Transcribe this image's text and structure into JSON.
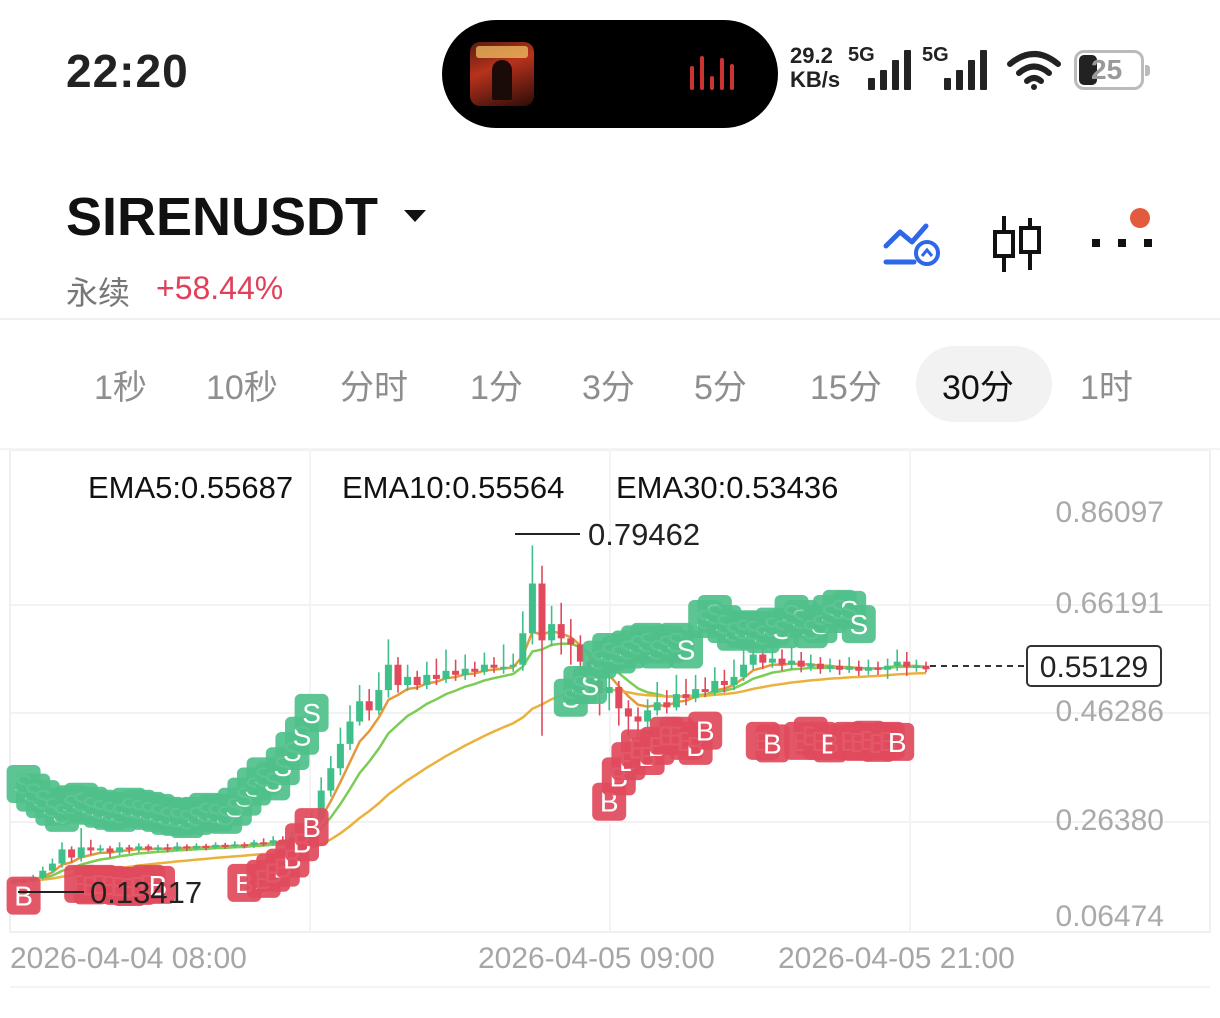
{
  "status_bar": {
    "time": "22:20",
    "net_speed_value": "29.2",
    "net_speed_unit": "KB/s",
    "signal1_label": "5G",
    "signal2_label": "5G",
    "battery": "25"
  },
  "header": {
    "symbol": "SIRENUSDT",
    "contract_type": "永续",
    "change": "+58.44%",
    "icons": [
      "indicator-alert-icon",
      "candlestick-icon",
      "more-icon"
    ]
  },
  "timeframes": [
    {
      "label": "1秒",
      "active": false
    },
    {
      "label": "10秒",
      "active": false
    },
    {
      "label": "分时",
      "active": false
    },
    {
      "label": "1分",
      "active": false
    },
    {
      "label": "3分",
      "active": false
    },
    {
      "label": "5分",
      "active": false
    },
    {
      "label": "15分",
      "active": false
    },
    {
      "label": "30分",
      "active": true
    },
    {
      "label": "1时",
      "active": false
    }
  ],
  "chart_data": {
    "type": "candlestick",
    "indicators": [
      {
        "name": "EMA5",
        "label": "EMA5:0.55687",
        "value": 0.55687,
        "color": "#e39a3a"
      },
      {
        "name": "EMA10",
        "label": "EMA10:0.55564",
        "value": 0.55564,
        "color": "#7ccc56"
      },
      {
        "name": "EMA30",
        "label": "EMA30:0.53436",
        "value": 0.53436,
        "color": "#eab23c"
      }
    ],
    "y_ticks": [
      "0.86097",
      "0.66191",
      "0.46286",
      "0.26380",
      "0.06474"
    ],
    "ylim": [
      0.06474,
      0.86097
    ],
    "x_ticks": [
      "2026-04-04 08:00",
      "2026-04-05 09:00",
      "2026-04-05 21:00"
    ],
    "high_label": "0.79462",
    "low_label": "0.13417",
    "current_price": "0.55129",
    "colors": {
      "up": "#3fbf8a",
      "down": "#e04a5c",
      "buy_marker": "#e04a5c",
      "sell_marker": "#4fc08a"
    },
    "candles": [
      [
        0.13,
        0.135,
        0.127,
        0.139
      ],
      [
        0.135,
        0.134,
        0.13,
        0.14
      ],
      [
        0.134,
        0.14,
        0.131,
        0.146
      ],
      [
        0.14,
        0.154,
        0.137,
        0.162
      ],
      [
        0.154,
        0.168,
        0.15,
        0.178
      ],
      [
        0.168,
        0.196,
        0.16,
        0.21
      ],
      [
        0.196,
        0.18,
        0.17,
        0.202
      ],
      [
        0.18,
        0.2,
        0.172,
        0.238
      ],
      [
        0.2,
        0.194,
        0.185,
        0.215
      ],
      [
        0.194,
        0.198,
        0.188,
        0.205
      ],
      [
        0.198,
        0.19,
        0.18,
        0.203
      ],
      [
        0.19,
        0.2,
        0.185,
        0.21
      ],
      [
        0.2,
        0.196,
        0.188,
        0.205
      ],
      [
        0.196,
        0.202,
        0.19,
        0.208
      ],
      [
        0.202,
        0.196,
        0.192,
        0.206
      ],
      [
        0.196,
        0.2,
        0.192,
        0.205
      ],
      [
        0.2,
        0.196,
        0.19,
        0.207
      ],
      [
        0.196,
        0.202,
        0.192,
        0.21
      ],
      [
        0.202,
        0.198,
        0.193,
        0.206
      ],
      [
        0.198,
        0.203,
        0.194,
        0.208
      ],
      [
        0.203,
        0.2,
        0.194,
        0.207
      ],
      [
        0.2,
        0.205,
        0.196,
        0.21
      ],
      [
        0.205,
        0.202,
        0.197,
        0.209
      ],
      [
        0.202,
        0.206,
        0.198,
        0.212
      ],
      [
        0.206,
        0.204,
        0.198,
        0.21
      ],
      [
        0.204,
        0.21,
        0.199,
        0.215
      ],
      [
        0.21,
        0.208,
        0.202,
        0.218
      ],
      [
        0.208,
        0.214,
        0.203,
        0.222
      ],
      [
        0.214,
        0.212,
        0.206,
        0.222
      ],
      [
        0.212,
        0.22,
        0.207,
        0.232
      ],
      [
        0.22,
        0.232,
        0.215,
        0.246
      ],
      [
        0.232,
        0.256,
        0.228,
        0.272
      ],
      [
        0.256,
        0.312,
        0.25,
        0.338
      ],
      [
        0.312,
        0.356,
        0.3,
        0.38
      ],
      [
        0.356,
        0.404,
        0.342,
        0.436
      ],
      [
        0.404,
        0.448,
        0.392,
        0.48
      ],
      [
        0.448,
        0.488,
        0.44,
        0.52
      ],
      [
        0.488,
        0.47,
        0.45,
        0.512
      ],
      [
        0.47,
        0.51,
        0.462,
        0.545
      ],
      [
        0.51,
        0.56,
        0.495,
        0.61
      ],
      [
        0.56,
        0.52,
        0.505,
        0.575
      ],
      [
        0.52,
        0.536,
        0.508,
        0.56
      ],
      [
        0.536,
        0.52,
        0.51,
        0.548
      ],
      [
        0.52,
        0.54,
        0.512,
        0.566
      ],
      [
        0.54,
        0.532,
        0.52,
        0.572
      ],
      [
        0.532,
        0.548,
        0.524,
        0.59
      ],
      [
        0.548,
        0.54,
        0.528,
        0.57
      ],
      [
        0.54,
        0.552,
        0.53,
        0.58
      ],
      [
        0.552,
        0.546,
        0.536,
        0.566
      ],
      [
        0.546,
        0.56,
        0.54,
        0.584
      ],
      [
        0.56,
        0.554,
        0.544,
        0.575
      ],
      [
        0.554,
        0.556,
        0.542,
        0.6
      ],
      [
        0.556,
        0.56,
        0.546,
        0.582
      ],
      [
        0.56,
        0.622,
        0.548,
        0.665
      ],
      [
        0.622,
        0.72,
        0.6,
        0.795
      ],
      [
        0.72,
        0.608,
        0.42,
        0.755
      ],
      [
        0.608,
        0.64,
        0.596,
        0.676
      ],
      [
        0.64,
        0.612,
        0.58,
        0.682
      ],
      [
        0.612,
        0.6,
        0.56,
        0.65
      ],
      [
        0.6,
        0.566,
        0.54,
        0.618
      ],
      [
        0.566,
        0.528,
        0.504,
        0.576
      ],
      [
        0.528,
        0.504,
        0.46,
        0.538
      ],
      [
        0.504,
        0.516,
        0.47,
        0.544
      ],
      [
        0.516,
        0.474,
        0.44,
        0.528
      ],
      [
        0.474,
        0.458,
        0.42,
        0.49
      ],
      [
        0.458,
        0.448,
        0.41,
        0.476
      ],
      [
        0.448,
        0.47,
        0.436,
        0.492
      ],
      [
        0.47,
        0.486,
        0.46,
        0.526
      ],
      [
        0.486,
        0.476,
        0.464,
        0.51
      ],
      [
        0.476,
        0.502,
        0.47,
        0.54
      ],
      [
        0.502,
        0.494,
        0.48,
        0.532
      ],
      [
        0.494,
        0.512,
        0.486,
        0.54
      ],
      [
        0.512,
        0.506,
        0.496,
        0.535
      ],
      [
        0.506,
        0.528,
        0.5,
        0.555
      ],
      [
        0.528,
        0.52,
        0.505,
        0.55
      ],
      [
        0.52,
        0.536,
        0.51,
        0.57
      ],
      [
        0.536,
        0.56,
        0.528,
        0.6
      ],
      [
        0.56,
        0.58,
        0.55,
        0.63
      ],
      [
        0.58,
        0.564,
        0.552,
        0.62
      ],
      [
        0.564,
        0.572,
        0.554,
        0.605
      ],
      [
        0.572,
        0.56,
        0.548,
        0.59
      ],
      [
        0.56,
        0.568,
        0.55,
        0.595
      ],
      [
        0.568,
        0.556,
        0.545,
        0.585
      ],
      [
        0.556,
        0.562,
        0.548,
        0.58
      ],
      [
        0.562,
        0.552,
        0.542,
        0.575
      ],
      [
        0.552,
        0.558,
        0.545,
        0.572
      ],
      [
        0.558,
        0.55,
        0.54,
        0.57
      ],
      [
        0.55,
        0.556,
        0.544,
        0.575
      ],
      [
        0.556,
        0.548,
        0.538,
        0.568
      ],
      [
        0.548,
        0.554,
        0.54,
        0.57
      ],
      [
        0.554,
        0.55,
        0.54,
        0.566
      ],
      [
        0.55,
        0.558,
        0.532,
        0.572
      ],
      [
        0.558,
        0.566,
        0.548,
        0.59
      ],
      [
        0.566,
        0.556,
        0.538,
        0.585
      ],
      [
        0.556,
        0.558,
        0.546,
        0.57
      ],
      [
        0.558,
        0.551,
        0.545,
        0.566
      ]
    ],
    "buy_markers": [
      [
        1,
        0.105
      ],
      [
        7,
        0.128
      ],
      [
        8,
        0.125
      ],
      [
        9,
        0.128
      ],
      [
        10,
        0.126
      ],
      [
        11,
        0.124
      ],
      [
        12,
        0.122
      ],
      [
        13,
        0.124
      ],
      [
        14,
        0.128
      ],
      [
        15,
        0.126
      ],
      [
        24,
        0.13
      ],
      [
        26,
        0.138
      ],
      [
        27,
        0.15
      ],
      [
        28,
        0.16
      ],
      [
        29,
        0.178
      ],
      [
        30,
        0.21
      ],
      [
        31,
        0.24
      ],
      [
        62,
        0.29
      ],
      [
        63,
        0.34
      ],
      [
        64,
        0.37
      ],
      [
        65,
        0.395
      ],
      [
        66,
        0.38
      ],
      [
        67,
        0.4
      ],
      [
        68,
        0.42
      ],
      [
        69,
        0.42
      ],
      [
        70,
        0.41
      ],
      [
        71,
        0.4
      ],
      [
        72,
        0.43
      ],
      [
        78,
        0.41
      ],
      [
        79,
        0.405
      ],
      [
        82,
        0.41
      ],
      [
        83,
        0.42
      ],
      [
        84,
        0.41
      ],
      [
        85,
        0.405
      ],
      [
        87,
        0.41
      ],
      [
        88,
        0.408
      ],
      [
        89,
        0.412
      ],
      [
        90,
        0.406
      ],
      [
        91,
        0.41
      ],
      [
        92,
        0.408
      ]
    ],
    "sell_markers": [
      [
        1,
        0.325
      ],
      [
        2,
        0.308
      ],
      [
        3,
        0.295
      ],
      [
        4,
        0.28
      ],
      [
        5,
        0.268
      ],
      [
        6,
        0.285
      ],
      [
        7,
        0.29
      ],
      [
        8,
        0.282
      ],
      [
        9,
        0.276
      ],
      [
        10,
        0.272
      ],
      [
        11,
        0.268
      ],
      [
        12,
        0.28
      ],
      [
        13,
        0.276
      ],
      [
        14,
        0.272
      ],
      [
        15,
        0.268
      ],
      [
        16,
        0.262
      ],
      [
        17,
        0.26
      ],
      [
        18,
        0.256
      ],
      [
        19,
        0.262
      ],
      [
        20,
        0.27
      ],
      [
        21,
        0.268
      ],
      [
        22,
        0.264
      ],
      [
        23,
        0.28
      ],
      [
        24,
        0.3
      ],
      [
        25,
        0.32
      ],
      [
        26,
        0.34
      ],
      [
        27,
        0.33
      ],
      [
        28,
        0.36
      ],
      [
        29,
        0.39
      ],
      [
        30,
        0.42
      ],
      [
        31,
        0.465
      ],
      [
        58,
        0.495
      ],
      [
        59,
        0.52
      ],
      [
        60,
        0.52
      ],
      [
        61,
        0.57
      ],
      [
        62,
        0.585
      ],
      [
        63,
        0.58
      ],
      [
        64,
        0.59
      ],
      [
        65,
        0.6
      ],
      [
        66,
        0.605
      ],
      [
        67,
        0.59
      ],
      [
        68,
        0.6
      ],
      [
        69,
        0.605
      ],
      [
        70,
        0.59
      ],
      [
        72,
        0.65
      ],
      [
        73,
        0.66
      ],
      [
        74,
        0.64
      ],
      [
        75,
        0.625
      ],
      [
        76,
        0.63
      ],
      [
        77,
        0.628
      ],
      [
        78,
        0.62
      ],
      [
        79,
        0.635
      ],
      [
        80,
        0.63
      ],
      [
        81,
        0.66
      ],
      [
        82,
        0.65
      ],
      [
        83,
        0.63
      ],
      [
        84,
        0.64
      ],
      [
        85,
        0.66
      ],
      [
        86,
        0.67
      ],
      [
        87,
        0.668
      ],
      [
        88,
        0.64
      ]
    ]
  }
}
